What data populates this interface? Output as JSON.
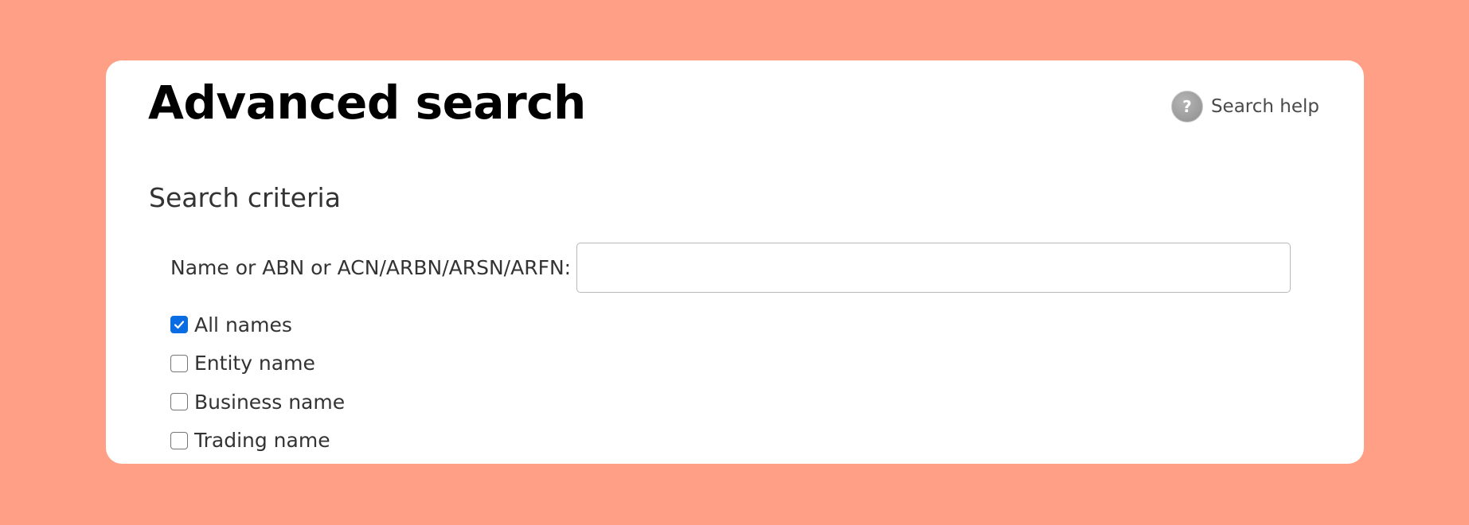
{
  "colors": {
    "background": "#FFA086",
    "card": "#FFFFFF",
    "checkbox_checked": "#0A6CE3",
    "help_icon": "#9A9A9A"
  },
  "header": {
    "title": "Advanced search",
    "help": {
      "icon": "question-mark-icon",
      "icon_glyph": "?",
      "label": "Search help"
    }
  },
  "criteria": {
    "heading": "Search criteria",
    "name_field": {
      "label": "Name or ABN or ACN/ARBN/ARSN/ARFN:",
      "value": "",
      "placeholder": ""
    },
    "checkboxes": [
      {
        "label": "All names",
        "checked": true
      },
      {
        "label": "Entity name",
        "checked": false
      },
      {
        "label": "Business name",
        "checked": false
      },
      {
        "label": "Trading name",
        "checked": false
      }
    ]
  }
}
